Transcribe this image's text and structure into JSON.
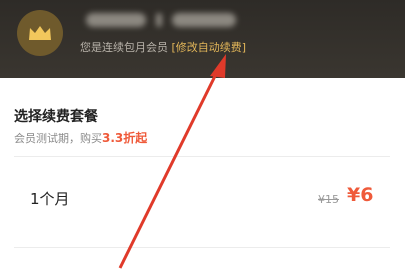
{
  "header": {
    "avatar_icon": "crown-icon",
    "member_status": "您是连续包月会员",
    "modify_link": "[修改自动续费]",
    "colors": {
      "background": "#34302b",
      "accent": "#e2b659"
    }
  },
  "plans": {
    "title": "选择续费套餐",
    "trial_prefix": "会员测试期，购买",
    "trial_discount": "3.3折起",
    "items": [
      {
        "name": "1个月",
        "original_price": "¥15",
        "price": "¥6"
      }
    ]
  },
  "annotation": {
    "icon": "red-arrow-icon",
    "color": "#e03a2a"
  }
}
